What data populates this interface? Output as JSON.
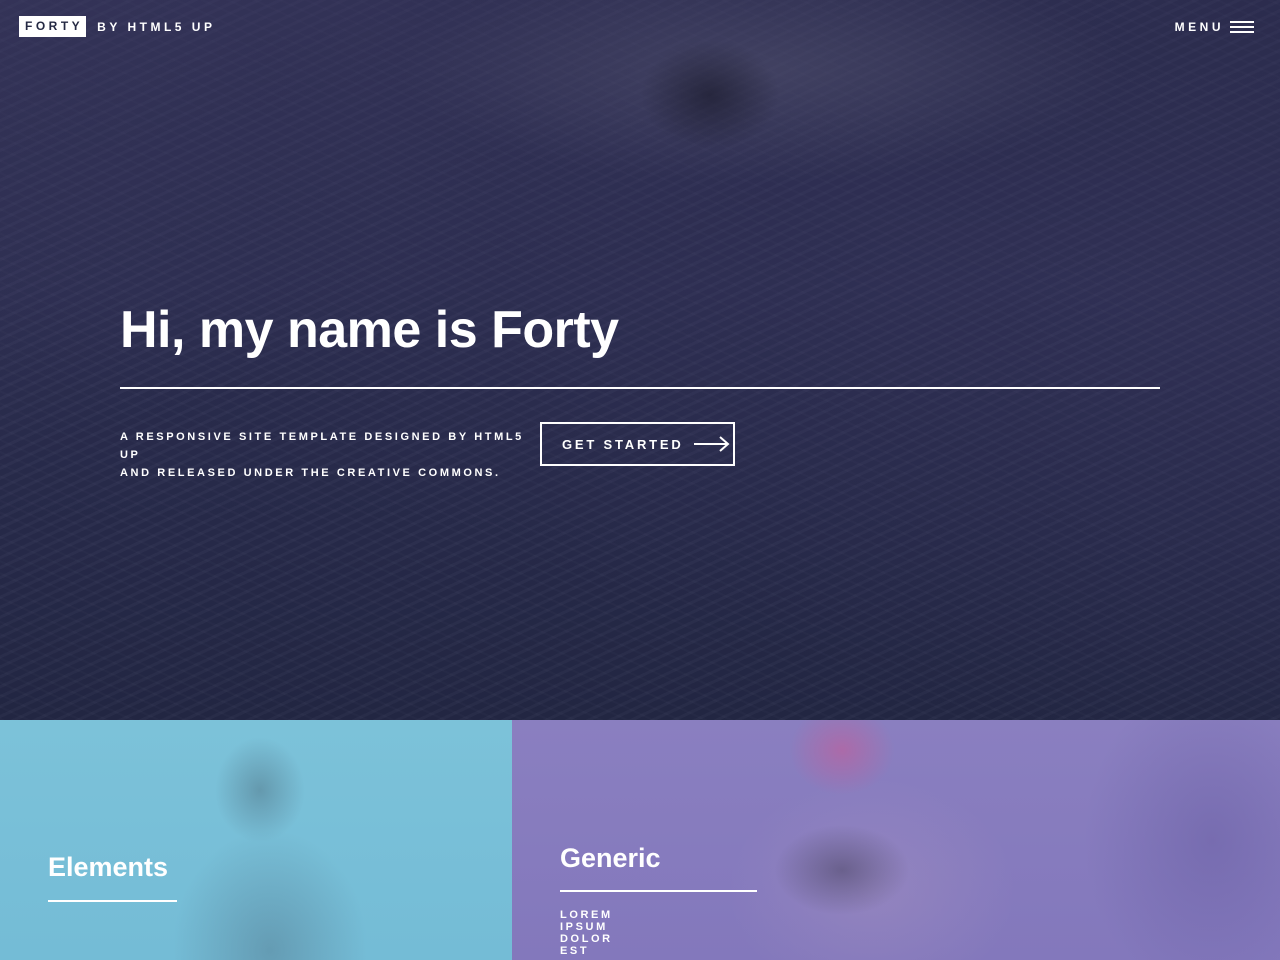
{
  "header": {
    "logo_box": "FORTY",
    "logo_rest": "BY HTML5 UP",
    "menu_label": "MENU"
  },
  "hero": {
    "title": "Hi, my name is Forty",
    "subtitle_line1": "A RESPONSIVE SITE TEMPLATE DESIGNED BY HTML5 UP",
    "subtitle_line2": "AND RELEASED UNDER THE CREATIVE COMMONS.",
    "cta_label": "GET STARTED"
  },
  "tiles": [
    {
      "title": "Elements",
      "subtitle": "",
      "color": "#7cc2d9"
    },
    {
      "title": "Generic",
      "subtitle": "LOREM IPSUM DOLOR EST",
      "color": "#8a7fc0"
    }
  ],
  "colors": {
    "background": "#242943",
    "text": "#ffffff"
  },
  "icons": {
    "menu": "hamburger-icon",
    "cta": "arrow-right-icon"
  }
}
